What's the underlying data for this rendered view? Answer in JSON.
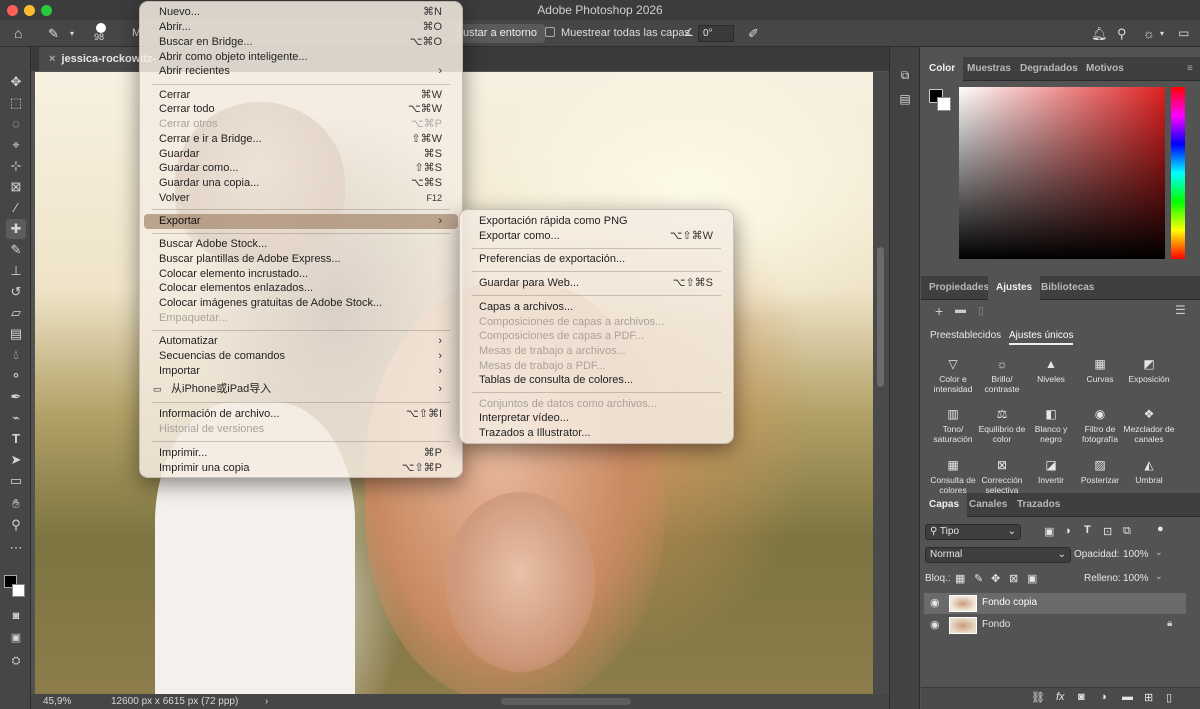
{
  "app": {
    "title": "Adobe Photoshop 2026"
  },
  "options_bar": {
    "brush_size": "98",
    "m_partial": "M",
    "ajustar_label": "ustar a entorno",
    "muestrear_label": "Muestrear todas las capas",
    "angle_value": "0°"
  },
  "document": {
    "tab_label": "jessica-rockowitz-",
    "zoom": "45,9%",
    "dimensions": "12600 px x 6615 px (72 ppp)"
  },
  "file_menu": {
    "items": [
      {
        "label": "Nuevo...",
        "shortcut": "⌘N"
      },
      {
        "label": "Abrir...",
        "shortcut": "⌘O"
      },
      {
        "label": "Buscar en Bridge...",
        "shortcut": "⌥⌘O"
      },
      {
        "label": "Abrir como objeto inteligente...",
        "shortcut": ""
      },
      {
        "label": "Abrir recientes",
        "shortcut": "›"
      },
      {
        "label": "Cerrar",
        "shortcut": "⌘W"
      },
      {
        "label": "Cerrar todo",
        "shortcut": "⌥⌘W"
      },
      {
        "label": "Cerrar otros",
        "shortcut": "⌥⌘P"
      },
      {
        "label": "Cerrar e ir a Bridge...",
        "shortcut": "⇧⌘W"
      },
      {
        "label": "Guardar",
        "shortcut": "⌘S"
      },
      {
        "label": "Guardar como...",
        "shortcut": "⇧⌘S"
      },
      {
        "label": "Guardar una copia...",
        "shortcut": "⌥⌘S"
      },
      {
        "label": "Volver",
        "shortcut": "F12"
      },
      {
        "label": "Exportar",
        "shortcut": "›"
      },
      {
        "label": "Buscar Adobe Stock...",
        "shortcut": ""
      },
      {
        "label": "Buscar plantillas de Adobe Express...",
        "shortcut": ""
      },
      {
        "label": "Colocar elemento incrustado...",
        "shortcut": ""
      },
      {
        "label": "Colocar elementos enlazados...",
        "shortcut": ""
      },
      {
        "label": "Colocar imágenes gratuitas de Adobe Stock...",
        "shortcut": ""
      },
      {
        "label": "Empaquetar...",
        "shortcut": ""
      },
      {
        "label": "Automatizar",
        "shortcut": "›"
      },
      {
        "label": "Secuencias de comandos",
        "shortcut": "›"
      },
      {
        "label": "Importar",
        "shortcut": "›"
      },
      {
        "label": "从iPhone或iPad导入",
        "shortcut": "›"
      },
      {
        "label": "Información de archivo...",
        "shortcut": "⌥⇧⌘I"
      },
      {
        "label": "Historial de versiones",
        "shortcut": ""
      },
      {
        "label": "Imprimir...",
        "shortcut": "⌘P"
      },
      {
        "label": "Imprimir una copia",
        "shortcut": "⌥⇧⌘P"
      }
    ]
  },
  "export_submenu": {
    "items": [
      {
        "label": "Exportación rápida como PNG",
        "shortcut": ""
      },
      {
        "label": "Exportar como...",
        "shortcut": "⌥⇧⌘W"
      },
      {
        "label": "Preferencias de exportación...",
        "shortcut": ""
      },
      {
        "label": "Guardar para Web...",
        "shortcut": "⌥⇧⌘S"
      },
      {
        "label": "Capas a archivos...",
        "shortcut": ""
      },
      {
        "label": "Composiciones de capas a archivos...",
        "shortcut": ""
      },
      {
        "label": "Composiciones de capas a PDF...",
        "shortcut": ""
      },
      {
        "label": "Mesas de trabajo a archivos...",
        "shortcut": ""
      },
      {
        "label": "Mesas de trabajo a PDF...",
        "shortcut": ""
      },
      {
        "label": "Tablas de consulta de colores...",
        "shortcut": ""
      },
      {
        "label": "Conjuntos de datos como archivos...",
        "shortcut": ""
      },
      {
        "label": "Interpretar vídeo...",
        "shortcut": ""
      },
      {
        "label": "Trazados a Illustrator...",
        "shortcut": ""
      }
    ]
  },
  "color_panel": {
    "tabs": [
      "Color",
      "Muestras",
      "Degradados",
      "Motivos"
    ]
  },
  "props_panel": {
    "tabs": [
      "Propiedades",
      "Ajustes",
      "Bibliotecas"
    ],
    "subtabs": [
      "Preestablecidos",
      "Ajustes únicos"
    ],
    "adjustments": [
      {
        "label": "Color e intensidad",
        "icon": "triangle-icon"
      },
      {
        "label": "Brillo/ contraste",
        "icon": "sun-icon"
      },
      {
        "label": "Niveles",
        "icon": "levels-icon"
      },
      {
        "label": "Curvas",
        "icon": "curves-icon"
      },
      {
        "label": "Exposición",
        "icon": "exposure-icon"
      },
      {
        "label": "Tono/ saturación",
        "icon": "hue-icon"
      },
      {
        "label": "Equilibrio de color",
        "icon": "balance-icon"
      },
      {
        "label": "Blanco y negro",
        "icon": "bw-icon"
      },
      {
        "label": "Filtro de fotografía",
        "icon": "camera-icon"
      },
      {
        "label": "Mezclador de canales",
        "icon": "mixer-icon"
      },
      {
        "label": "Consulta de colores",
        "icon": "grid-icon"
      },
      {
        "label": "Corrección selectiva",
        "icon": "selective-icon"
      },
      {
        "label": "Invertir",
        "icon": "invert-icon"
      },
      {
        "label": "Posterizar",
        "icon": "posterize-icon"
      },
      {
        "label": "Umbral",
        "icon": "threshold-icon"
      }
    ]
  },
  "layers_panel": {
    "tabs": [
      "Capas",
      "Canales",
      "Trazados"
    ],
    "filter": "Tipo",
    "blend_mode": "Normal",
    "opacity_label": "Opacidad:",
    "opacity_value": "100%",
    "lock_label": "Bloq.:",
    "fill_label": "Relleno:",
    "fill_value": "100%",
    "layers": [
      {
        "name": "Fondo copia"
      },
      {
        "name": "Fondo"
      }
    ]
  },
  "colors": {
    "accent": "#f0f0f0",
    "menu_bg": "#f4ece2",
    "panel_bg": "#535353"
  }
}
